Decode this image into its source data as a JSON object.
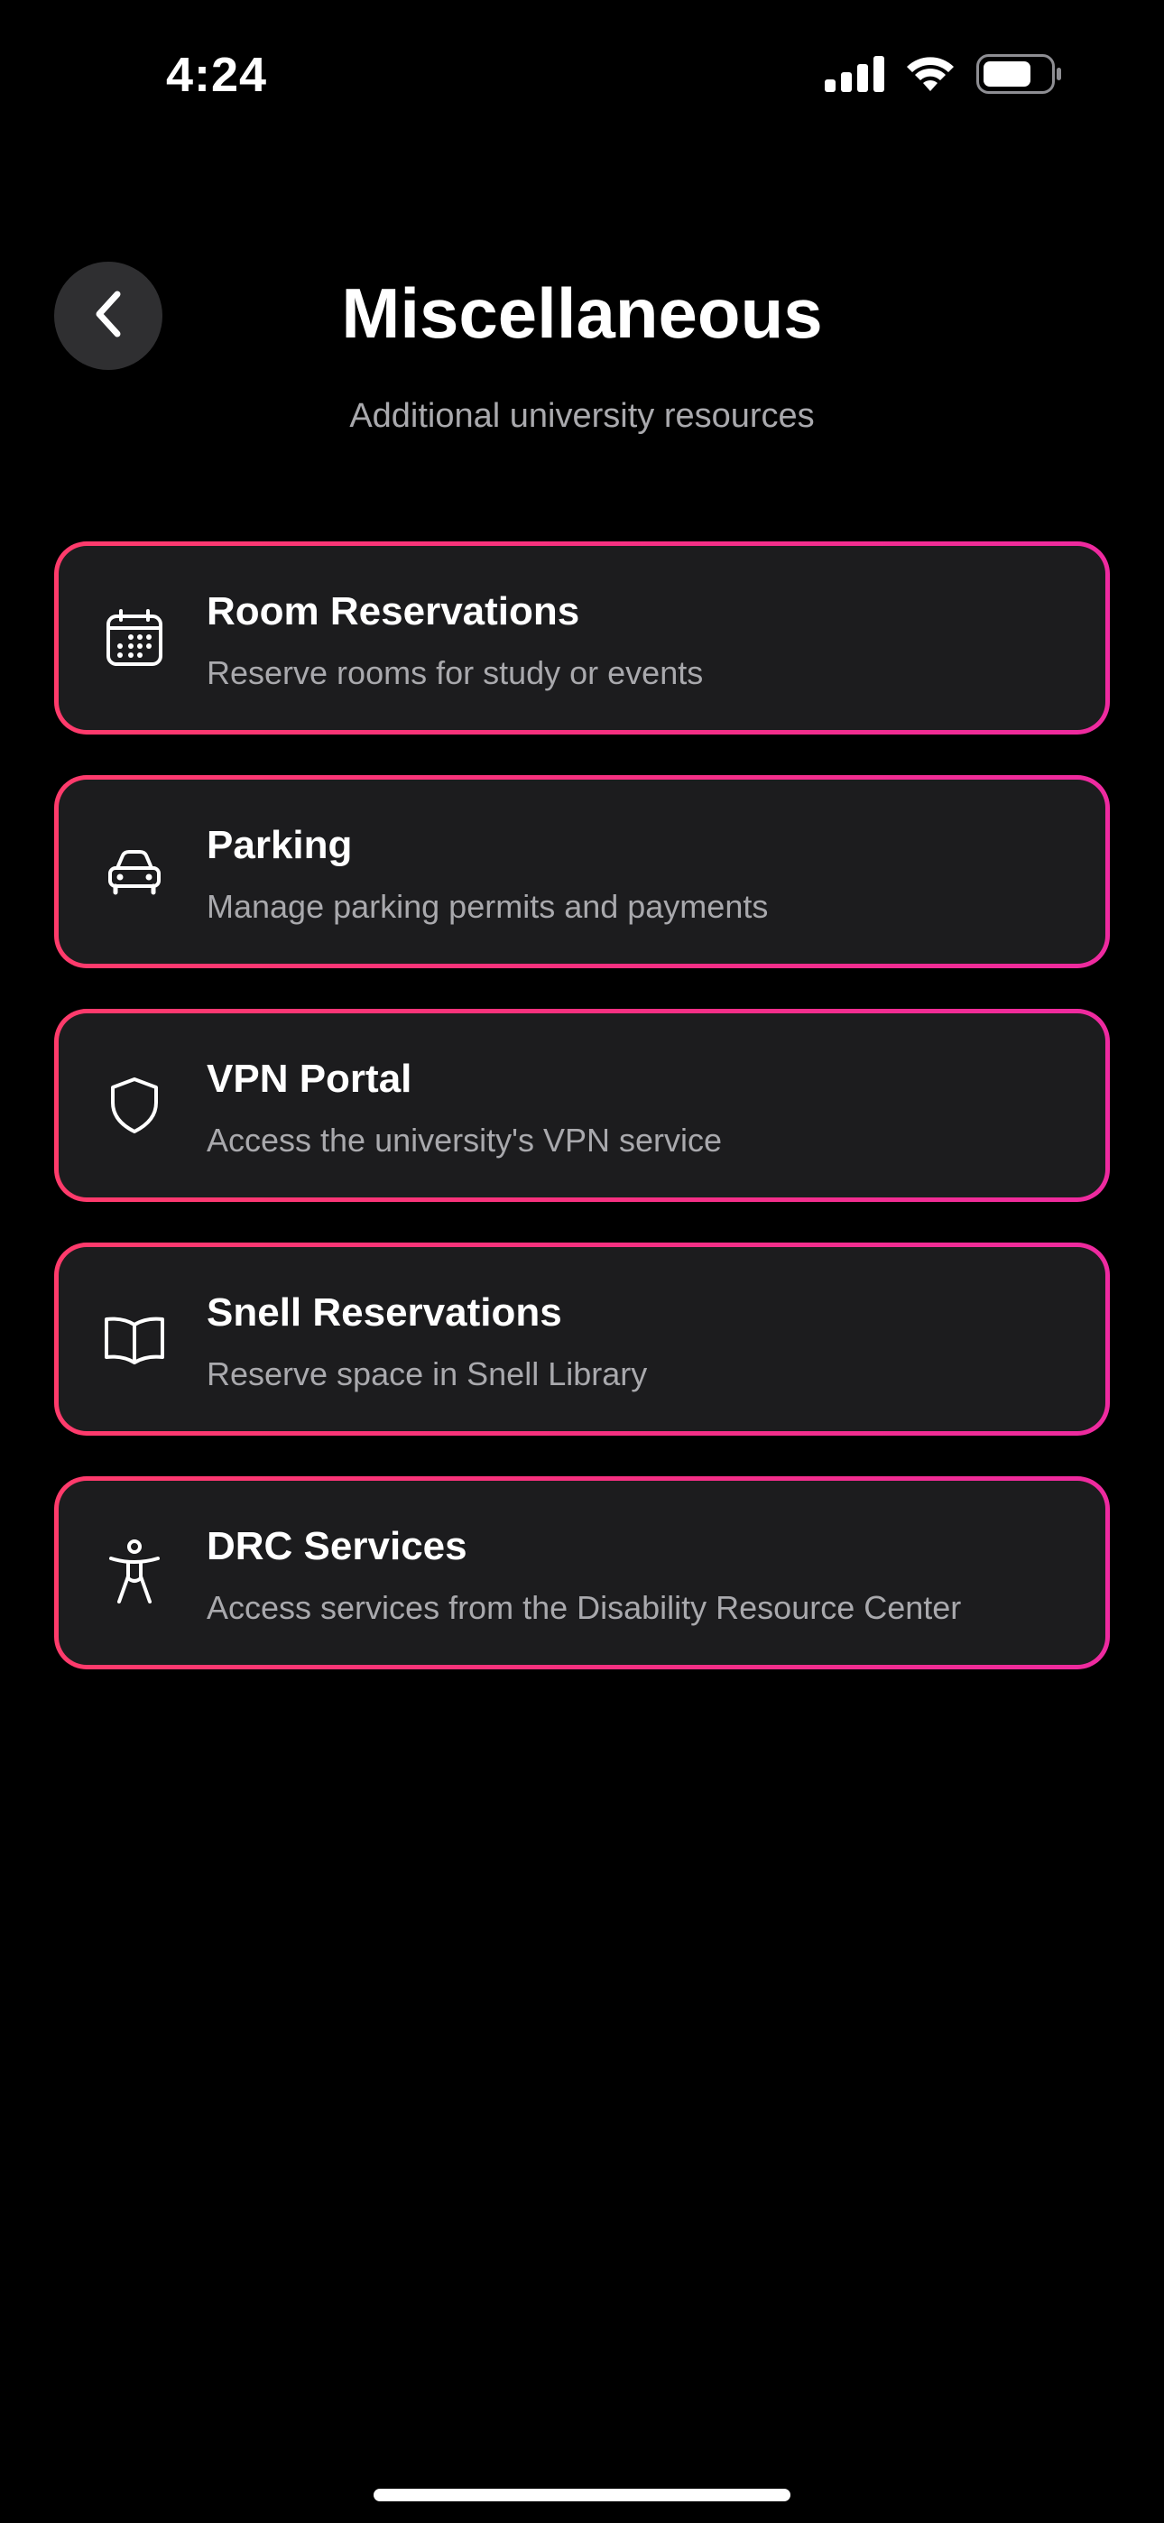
{
  "status_bar": {
    "time": "4:24",
    "icons": [
      "cellular-signal-icon",
      "wifi-icon",
      "battery-icon"
    ]
  },
  "header": {
    "back_icon": "chevron-left-icon",
    "title": "Miscellaneous",
    "subtitle": "Additional university resources"
  },
  "colors": {
    "background": "#000000",
    "card_background": "#1c1c1e",
    "card_border_gradient": [
      "#ff3b6b",
      "#ee2aa0"
    ],
    "subtitle_text": "#a9a9ad"
  },
  "cards": [
    {
      "icon": "calendar-icon",
      "title": "Room Reservations",
      "description": "Reserve rooms for study or events"
    },
    {
      "icon": "car-icon",
      "title": "Parking",
      "description": "Manage parking permits and payments"
    },
    {
      "icon": "shield-icon",
      "title": "VPN Portal",
      "description": "Access the university's VPN service"
    },
    {
      "icon": "book-icon",
      "title": "Snell Reservations",
      "description": "Reserve space in Snell Library"
    },
    {
      "icon": "accessibility-icon",
      "title": "DRC Services",
      "description": "Access services from the Disability Resource Center"
    }
  ]
}
